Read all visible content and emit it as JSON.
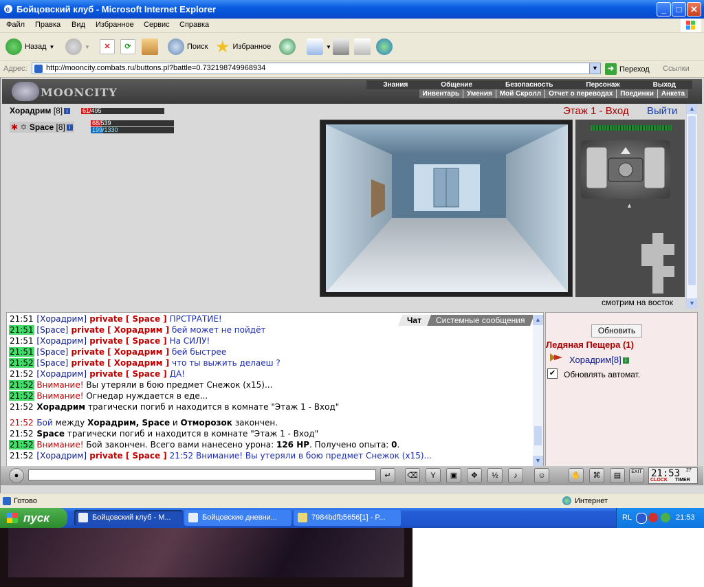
{
  "window": {
    "title": "Бойцовский клуб - Microsoft Internet Explorer",
    "minimize": "_",
    "maximize": "□",
    "close": "✕"
  },
  "menu": [
    "Файл",
    "Правка",
    "Вид",
    "Избранное",
    "Сервис",
    "Справка"
  ],
  "toolbar": {
    "back": "Назад",
    "search": "Поиск",
    "favorites": "Избранное"
  },
  "address": {
    "label": "Адрес:",
    "url": "http://mooncity.combats.ru/buttons.pl?battle=0.732198749968934",
    "go": "Переход",
    "links": "Ссылки"
  },
  "game": {
    "logo": "MOONCITY",
    "nav_top": [
      "Знания",
      "Общение",
      "Безопасность",
      "Персонаж",
      "Выход"
    ],
    "nav_bottom": [
      "Инвентарь",
      "Умения",
      "Мой Скролл",
      "Отчет о переводах",
      "Поединки",
      "Анкета"
    ],
    "player": {
      "name": "Хорадрим",
      "level": "[8]",
      "hp": "61/495",
      "hp_fraction": 0.12
    },
    "companion": {
      "name": "Space",
      "level": "[8]",
      "hp": "68/539",
      "hp_fraction": 0.13,
      "mana": "199/1330",
      "mana_fraction": 0.15
    },
    "floor_title": "Этаж 1 - Вход",
    "exit": "Выйти",
    "direction": "смотрим на восток"
  },
  "chat": {
    "tabs": [
      "Чат",
      "Системные сообщения"
    ],
    "messages": [
      {
        "time": "21:51",
        "hl": false,
        "parts": [
          [
            "nm",
            "[Хорадрим]"
          ],
          [
            "pv",
            " private [ Space ]"
          ],
          [
            "tx",
            " ПРСТРАТИЕ!"
          ]
        ]
      },
      {
        "time": "21:51",
        "hl": true,
        "parts": [
          [
            "nm",
            "[Space]"
          ],
          [
            "pv",
            " private [ Хорадрим ]"
          ],
          [
            "tx",
            " бей может не пойдёт"
          ]
        ]
      },
      {
        "time": "21:51",
        "hl": false,
        "parts": [
          [
            "nm",
            "[Хорадрим]"
          ],
          [
            "pv",
            " private [ Space ]"
          ],
          [
            "tx",
            " На СИЛУ!"
          ]
        ]
      },
      {
        "time": "21:51",
        "hl": true,
        "parts": [
          [
            "nm",
            "[Space]"
          ],
          [
            "pv",
            " private [ Хорадрим ]"
          ],
          [
            "tx",
            " бей быстрее"
          ]
        ]
      },
      {
        "time": "21:52",
        "hl": true,
        "parts": [
          [
            "nm",
            "[Space]"
          ],
          [
            "pv",
            " private [ Хорадрим ]"
          ],
          [
            "tx",
            " что ты выжить делаеш ?"
          ]
        ]
      },
      {
        "time": "21:52",
        "hl": false,
        "parts": [
          [
            "nm",
            "[Хорадрим]"
          ],
          [
            "pv",
            " private [ Space ]"
          ],
          [
            "tx",
            " ДА!"
          ]
        ]
      },
      {
        "time": "21:52",
        "hl": true,
        "parts": [
          [
            "red",
            "Внимание!"
          ],
          [
            "pl",
            " Вы утеряли в бою предмет Снежок (x15)..."
          ]
        ]
      },
      {
        "time": "21:52",
        "hl": true,
        "parts": [
          [
            "red",
            "Внимание!"
          ],
          [
            "pl",
            " Огнедар нуждается в еде..."
          ]
        ]
      },
      {
        "time": "21:52",
        "hl": false,
        "parts": [
          [
            "b",
            " Хорадрим"
          ],
          [
            "pl",
            " трагически погиб и находится в комнате \"Этаж 1 - Вход\""
          ]
        ]
      },
      {
        "time": "21:52",
        "hl": false,
        "redtime": true,
        "parts": [
          [
            "tx",
            "Бой"
          ],
          [
            "pl",
            " между "
          ],
          [
            "b",
            "Хорадрим, Space"
          ],
          [
            "pl",
            " и "
          ],
          [
            "b",
            "Отморозок"
          ],
          [
            "pl",
            "  закончен."
          ]
        ]
      },
      {
        "time": "21:52",
        "hl": false,
        "parts": [
          [
            "b",
            " Space"
          ],
          [
            "pl",
            " трагически погиб и находится в комнате \"Этаж 1 - Вход\""
          ]
        ]
      },
      {
        "time": "21:52",
        "hl": true,
        "parts": [
          [
            "red",
            "Внимание!"
          ],
          [
            "pl",
            " Бой закончен. Всего вами нанесено урона: "
          ],
          [
            "b",
            "126 HP"
          ],
          [
            "pl",
            ". Получено опыта: "
          ],
          [
            "b",
            "0"
          ],
          [
            "pl",
            "."
          ]
        ]
      },
      {
        "time": "21:52",
        "hl": false,
        "parts": [
          [
            "nm",
            "[Хорадрим]"
          ],
          [
            "pv",
            " private [ Space ]"
          ],
          [
            "tx",
            " 21:52 Внимание! Вы утеряли в бою предмет Снежок (x15)..."
          ]
        ]
      }
    ]
  },
  "room": {
    "refresh": "Обновить",
    "name": "Ледяная Пещера (1)",
    "user": "Хорадрим[8]",
    "auto_refresh": "Обновлять автомат.",
    "auto_checked": true
  },
  "clock": {
    "time": "21:53",
    "sec": "27",
    "clock_label": "CLOCK",
    "timer_label": "TIMER",
    "exit_label": "EXIT"
  },
  "status": {
    "text": "Готово",
    "zone": "Интернет"
  },
  "taskbar": {
    "start": "пуск",
    "tasks": [
      "Бойцовский клуб - M...",
      "Бойцовские дневни...",
      "7984bdfb5656[1] - P..."
    ],
    "lang": "RL",
    "time": "21:53"
  }
}
